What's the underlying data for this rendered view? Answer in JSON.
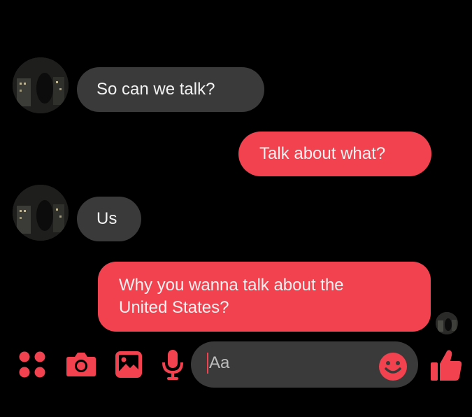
{
  "conversation": {
    "messages": [
      {
        "sender": "contact",
        "text": "So can we talk?"
      },
      {
        "sender": "me",
        "text": "Talk about what?"
      },
      {
        "sender": "contact",
        "text": "Us"
      },
      {
        "sender": "me",
        "line1": "Why you wanna talk about the",
        "line2": "United States?"
      }
    ]
  },
  "composer": {
    "input_placeholder": "Aa",
    "icons": [
      "apps-icon",
      "camera-icon",
      "image-icon",
      "microphone-icon",
      "emoji-icon",
      "thumbs-up-icon"
    ]
  },
  "colors": {
    "background": "#000000",
    "incoming_bubble": "#3a3a3a",
    "outgoing_bubble": "#f2424f",
    "accent": "#f2424f",
    "text": "#f2f2f2"
  }
}
